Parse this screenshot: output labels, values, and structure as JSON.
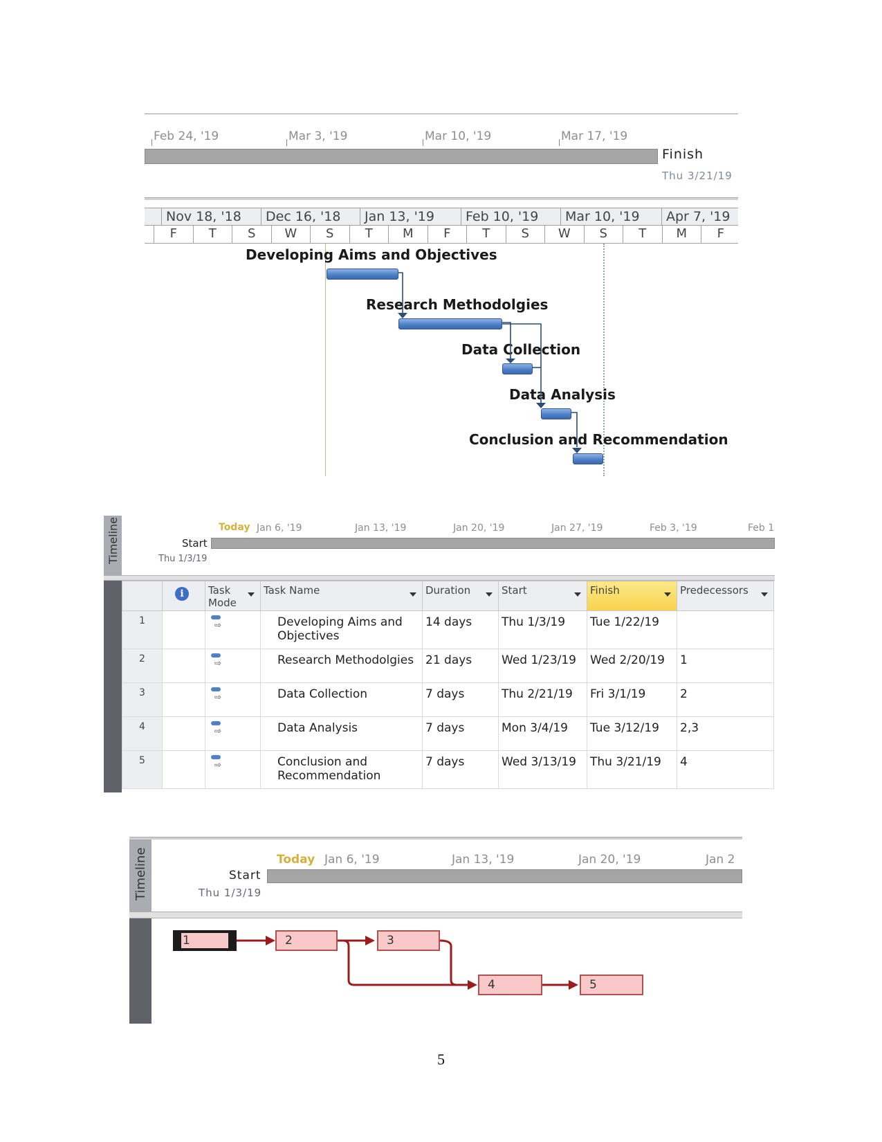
{
  "section1": {
    "timeline": {
      "ticks": [
        "Feb 24, '19",
        "Mar 3, '19",
        "Mar 10, '19",
        "Mar 17, '19"
      ],
      "finish_label": "Finish",
      "finish_date": "Thu 3/21/19"
    },
    "gantt_header": {
      "months": [
        "Nov 18, '18",
        "Dec 16, '18",
        "Jan 13, '19",
        "Feb 10, '19",
        "Mar 10, '19",
        "Apr 7, '19"
      ],
      "days": [
        "F",
        "T",
        "S",
        "W",
        "S",
        "T",
        "M",
        "F",
        "T",
        "S",
        "W",
        "S",
        "T",
        "M",
        "F"
      ]
    },
    "bars": [
      {
        "id": 1,
        "label": "Developing Aims and Objectives"
      },
      {
        "id": 2,
        "label": "Research Methodolgies"
      },
      {
        "id": 3,
        "label": "Data Collection"
      },
      {
        "id": 4,
        "label": "Data Analysis"
      },
      {
        "id": 5,
        "label": "Conclusion and Recommendation"
      }
    ]
  },
  "section2": {
    "side_label": "Timeline",
    "today_label": "Today",
    "ticks": [
      "Jan 6, '19",
      "Jan 13, '19",
      "Jan 20, '19",
      "Jan 27, '19",
      "Feb 3, '19",
      "Feb 1"
    ],
    "start_label": "Start",
    "start_date": "Thu 1/3/19",
    "table": {
      "columns": [
        "",
        "Task Mode",
        "Task Name",
        "Duration",
        "Start",
        "Finish",
        "Predecessors"
      ],
      "info_icon": "i",
      "rows": [
        {
          "num": "1",
          "name": "Developing Aims and Objectives",
          "duration": "14 days",
          "start": "Thu 1/3/19",
          "finish": "Tue 1/22/19",
          "pred": ""
        },
        {
          "num": "2",
          "name": "Research Methodolgies",
          "duration": "21 days",
          "start": "Wed 1/23/19",
          "finish": "Wed 2/20/19",
          "pred": "1"
        },
        {
          "num": "3",
          "name": "Data Collection",
          "duration": "7 days",
          "start": "Thu 2/21/19",
          "finish": "Fri 3/1/19",
          "pred": "2"
        },
        {
          "num": "4",
          "name": "Data Analysis",
          "duration": "7 days",
          "start": "Mon 3/4/19",
          "finish": "Tue 3/12/19",
          "pred": "2,3"
        },
        {
          "num": "5",
          "name": "Conclusion and Recommendation",
          "duration": "7 days",
          "start": "Wed 3/13/19",
          "finish": "Thu 3/21/19",
          "pred": "4"
        }
      ]
    }
  },
  "section3": {
    "side_label": "Timeline",
    "today_label": "Today",
    "ticks": [
      "Jan 6, '19",
      "Jan 13, '19",
      "Jan 20, '19",
      "Jan 2"
    ],
    "start_label": "Start",
    "start_date": "Thu 1/3/19",
    "nodes": [
      "1",
      "2",
      "3",
      "4",
      "5"
    ]
  },
  "page_number": "5",
  "colors": {
    "bar_blue": "#4f81c7",
    "highlight_yellow": "#f7d24b",
    "today_gold": "#d4b13a",
    "network_fill": "#f9c9c9",
    "network_link": "#9b1c1c"
  }
}
